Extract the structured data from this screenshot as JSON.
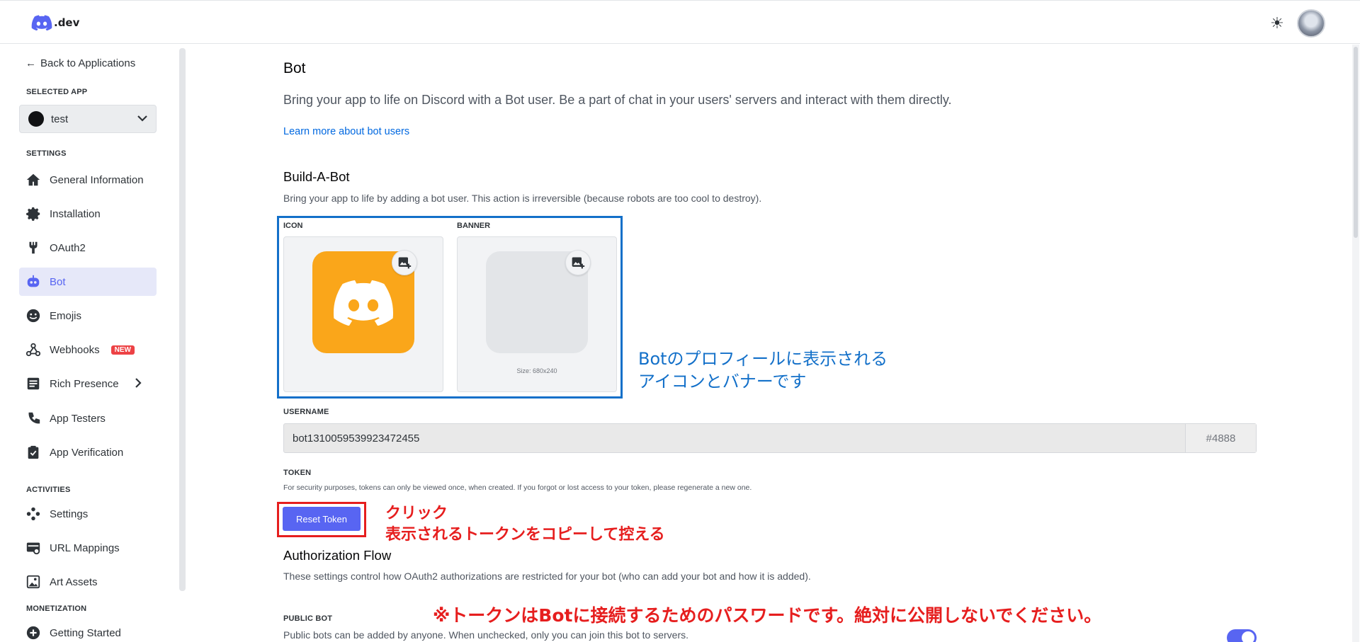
{
  "header": {
    "logo_text": ".dev",
    "theme_icon": "sun-icon",
    "avatar_icon": "user-avatar"
  },
  "sidebar": {
    "back_label": "Back to Applications",
    "selected_app_label": "SELECTED APP",
    "selected_app": "test",
    "settings_label": "SETTINGS",
    "settings_items": [
      {
        "label": "General Information",
        "icon": "home-icon"
      },
      {
        "label": "Installation",
        "icon": "gear-icon"
      },
      {
        "label": "OAuth2",
        "icon": "wrench-icon"
      },
      {
        "label": "Bot",
        "icon": "bot-icon",
        "active": true
      },
      {
        "label": "Emojis",
        "icon": "smile-icon"
      },
      {
        "label": "Webhooks",
        "icon": "webhook-icon",
        "badge": "NEW"
      },
      {
        "label": "Rich Presence",
        "icon": "document-icon"
      },
      {
        "label": "App Testers",
        "icon": "person-icon"
      },
      {
        "label": "App Verification",
        "icon": "clipboard-check-icon"
      }
    ],
    "activities_label": "ACTIVITIES",
    "activities_items": [
      {
        "label": "Settings",
        "icon": "activity-settings-icon"
      },
      {
        "label": "URL Mappings",
        "icon": "url-icon"
      },
      {
        "label": "Art Assets",
        "icon": "image-icon"
      }
    ],
    "monetization_label": "MONETIZATION",
    "monetization_items": [
      {
        "label": "Getting Started",
        "icon": "plus-circle-icon"
      }
    ]
  },
  "main": {
    "title": "Bot",
    "lead": "Bring your app to life on Discord with a Bot user. Be a part of chat in your users' servers and interact with them directly.",
    "learn_more": "Learn more about bot users",
    "build_title": "Build-A-Bot",
    "build_desc": "Bring your app to life by adding a bot user. This action is irreversible (because robots are too cool to destroy).",
    "icon_label": "ICON",
    "banner_label": "BANNER",
    "banner_size": "Size: 680x240",
    "username_label": "USERNAME",
    "username_value": "bot1310059539923472455",
    "discriminator": "#4888",
    "token_label": "TOKEN",
    "token_desc": "For security purposes, tokens can only be viewed once, when created. If you forgot or lost access to your token, please regenerate a new one.",
    "reset_token": "Reset Token",
    "auth_title": "Authorization Flow",
    "auth_desc": "These settings control how OAuth2 authorizations are restricted for your bot (who can add your bot and how it is added).",
    "public_bot_label": "PUBLIC BOT",
    "public_bot_desc": "Public bots can be added by anyone. When unchecked, only you can join this bot to servers.",
    "public_bot_enabled": true
  },
  "annotations": {
    "image_note_line1": "Botのプロフィールに表示される",
    "image_note_line2": "アイコンとバナーです",
    "click_note": "クリック",
    "copy_note": "表示されるトークンをコピーして控える",
    "warning": "※トークンはBotに接続するためのパスワードです。絶対に公開しないでください。"
  },
  "colors": {
    "accent": "#5865f2",
    "icon_bg": "#faa61a",
    "annotation_blue": "#1370c9",
    "annotation_red": "#e61e1e",
    "badge_red": "#ed4245"
  }
}
